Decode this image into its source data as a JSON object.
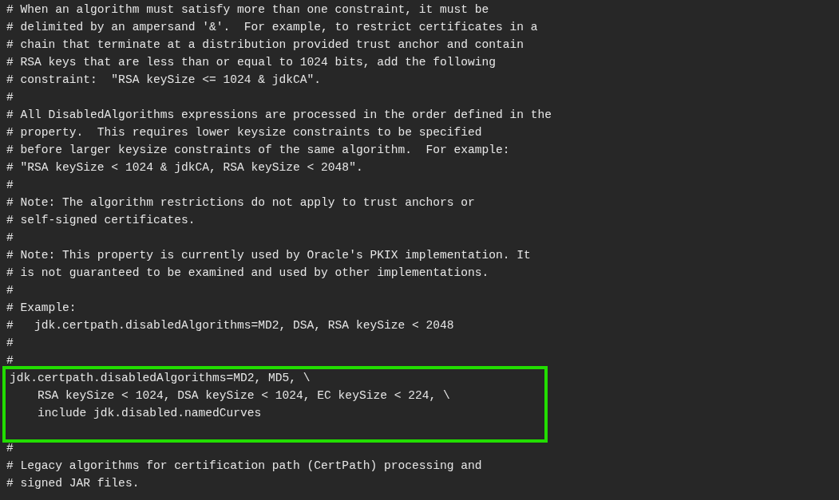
{
  "editor": {
    "blocks": [
      {
        "kind": "plain",
        "lines": [
          "# When an algorithm must satisfy more than one constraint, it must be",
          "# delimited by an ampersand '&'.  For example, to restrict certificates in a",
          "# chain that terminate at a distribution provided trust anchor and contain",
          "# RSA keys that are less than or equal to 1024 bits, add the following",
          "# constraint:  \"RSA keySize <= 1024 & jdkCA\".",
          "#",
          "# All DisabledAlgorithms expressions are processed in the order defined in the",
          "# property.  This requires lower keysize constraints to be specified",
          "# before larger keysize constraints of the same algorithm.  For example:",
          "# \"RSA keySize < 1024 & jdkCA, RSA keySize < 2048\".",
          "#",
          "# Note: The algorithm restrictions do not apply to trust anchors or",
          "# self-signed certificates.",
          "#",
          "# Note: This property is currently used by Oracle's PKIX implementation. It",
          "# is not guaranteed to be examined and used by other implementations.",
          "#",
          "# Example:",
          "#   jdk.certpath.disabledAlgorithms=MD2, DSA, RSA keySize < 2048",
          "#",
          "#"
        ]
      },
      {
        "kind": "highlighted",
        "lines": [
          "jdk.certpath.disabledAlgorithms=MD2, MD5, \\",
          "    RSA keySize < 1024, DSA keySize < 1024, EC keySize < 224, \\",
          "    include jdk.disabled.namedCurves"
        ]
      },
      {
        "kind": "plain",
        "lines": [
          "#",
          "# Legacy algorithms for certification path (CertPath) processing and",
          "# signed JAR files."
        ]
      }
    ]
  }
}
